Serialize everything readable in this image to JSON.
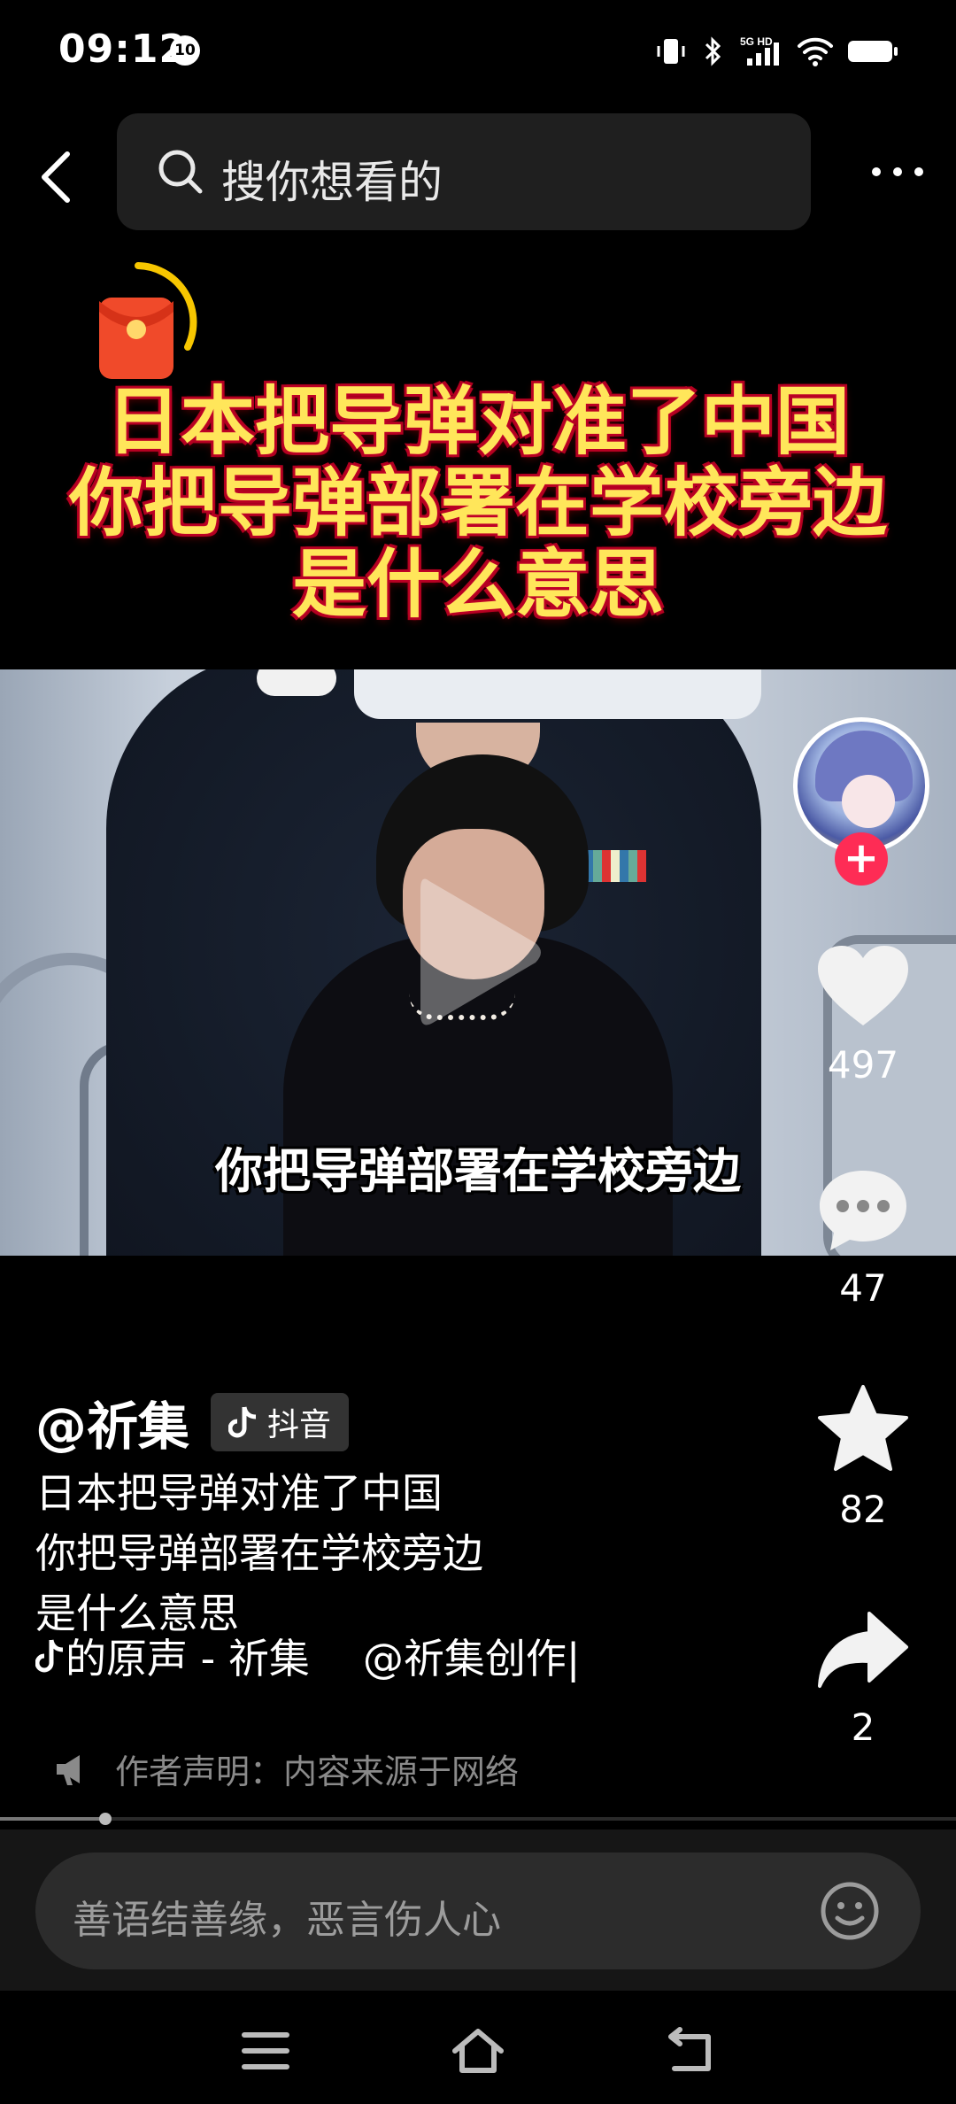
{
  "status_bar": {
    "time": "09:12",
    "notification_badge": "10",
    "network_label": "5G HD"
  },
  "top_bar": {
    "search_placeholder": "搜你想看的",
    "back_icon": "chevron-left-icon",
    "more_icon": "ellipsis-icon"
  },
  "video": {
    "title_lines": [
      "日本把导弹对准了中国",
      "你把导弹部署在学校旁边",
      "是什么意思"
    ],
    "subtitle": "你把导弹部署在学校旁边",
    "progress_fraction": 0.11
  },
  "actions": {
    "likes": "497",
    "comments": "47",
    "favorites": "82",
    "shares": "2"
  },
  "post": {
    "author": "@祈集",
    "platform_badge": "抖音",
    "description": "日本把导弹对准了中国\n你把导弹部署在学校旁边\n是什么意思",
    "music": "的原声 - 祈集",
    "music_credit": "@祈集创作|",
    "declaration": "作者声明：内容来源于网络"
  },
  "comment_bar": {
    "placeholder": "善语结善缘，恶言伤人心"
  },
  "colors": {
    "accent": "#fe2c55",
    "title_yellow": "#ffe65a",
    "title_red": "#b00020"
  }
}
